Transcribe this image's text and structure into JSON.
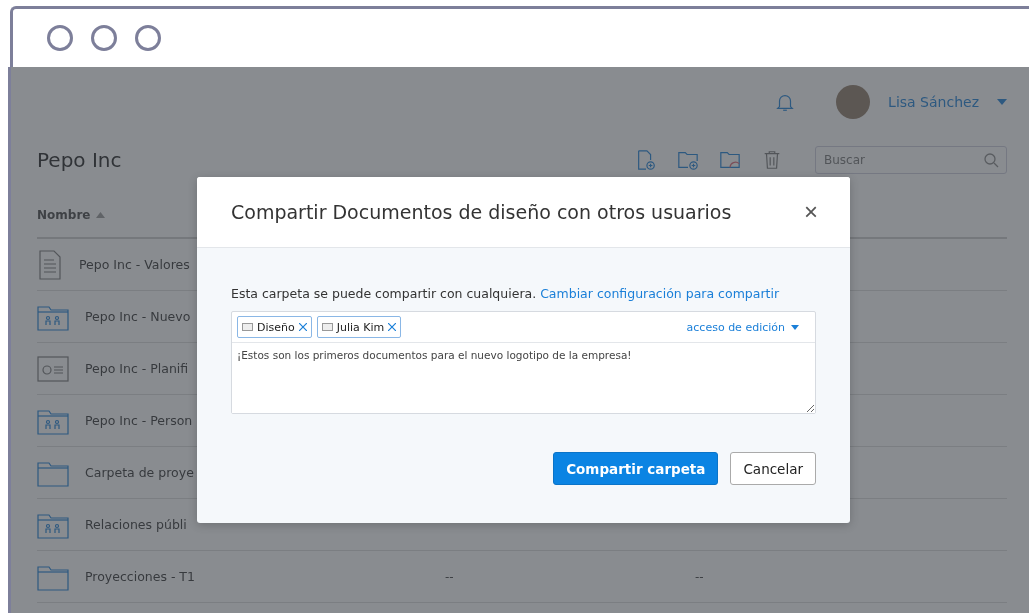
{
  "header": {
    "user_name": "Lisa Sánchez"
  },
  "page": {
    "title": "Pepo Inc",
    "search": {
      "placeholder": "Buscar"
    }
  },
  "table": {
    "columns": [
      {
        "label": "Nombre",
        "sorted": true
      }
    ],
    "rows": [
      {
        "kind": "document",
        "name": "Pepo Inc - Valores",
        "cells": []
      },
      {
        "kind": "shared-folder",
        "name": "Pepo Inc - Nuevo",
        "cells": []
      },
      {
        "kind": "presentation",
        "name": "Pepo Inc - Planifi",
        "cells": []
      },
      {
        "kind": "shared-folder",
        "name": "Pepo Inc - Person",
        "cells": []
      },
      {
        "kind": "folder",
        "name": "Carpeta de proye",
        "cells": []
      },
      {
        "kind": "shared-folder",
        "name": "Relaciones públi",
        "cells": []
      },
      {
        "kind": "folder",
        "name": "Proyecciones - T1",
        "cells": [
          "--",
          "--"
        ]
      }
    ]
  },
  "dialog": {
    "title": "Compartir Documentos de diseño con otros usuarios",
    "close": "×",
    "info": "Esta carpeta se puede compartir con cualquiera.",
    "link": "Cambiar configuración para compartir",
    "recipients": [
      {
        "label": "Diseño"
      },
      {
        "label": "Julia Kim"
      }
    ],
    "access": "acceso de edición",
    "message": "¡Estos son los primeros documentos para el nuevo logotipo de la empresa!",
    "buttons": [
      {
        "kind": "primary",
        "label": "Compartir carpeta"
      },
      {
        "kind": "secondary",
        "label": "Cancelar"
      }
    ]
  }
}
